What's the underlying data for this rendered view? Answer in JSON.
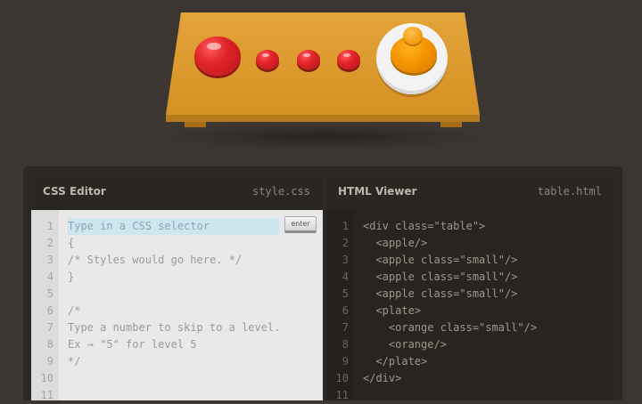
{
  "css_editor": {
    "title": "CSS Editor",
    "filename": "style.css",
    "input_placeholder": "Type in a CSS selector",
    "enter_label": "enter",
    "line_numbers": [
      "1",
      "2",
      "3",
      "4",
      "5",
      "6",
      "7",
      "8",
      "9",
      "10",
      "11"
    ],
    "lines": [
      "",
      "{",
      "/* Styles would go here. */",
      "}",
      "",
      "/*",
      "Type a number to skip to a level.",
      "Ex → \"5\" for level 5",
      "*/",
      "",
      ""
    ]
  },
  "html_viewer": {
    "title": "HTML Viewer",
    "filename": "table.html",
    "line_numbers": [
      "1",
      "2",
      "3",
      "4",
      "5",
      "6",
      "7",
      "8",
      "9",
      "10",
      "11"
    ],
    "lines": [
      "<div class=\"table\">",
      "  <apple/>",
      "  <apple class=\"small\"/>",
      "  <apple class=\"small\"/>",
      "  <apple class=\"small\"/>",
      "  <plate>",
      "    <orange class=\"small\"/>",
      "    <orange/>",
      "  </plate>",
      "</div>",
      ""
    ]
  },
  "colors": {
    "background": "#3b3631",
    "table": "#d89a2c",
    "apple": "#e0242a",
    "orange": "#f29300",
    "plate": "#f3f3f3"
  }
}
